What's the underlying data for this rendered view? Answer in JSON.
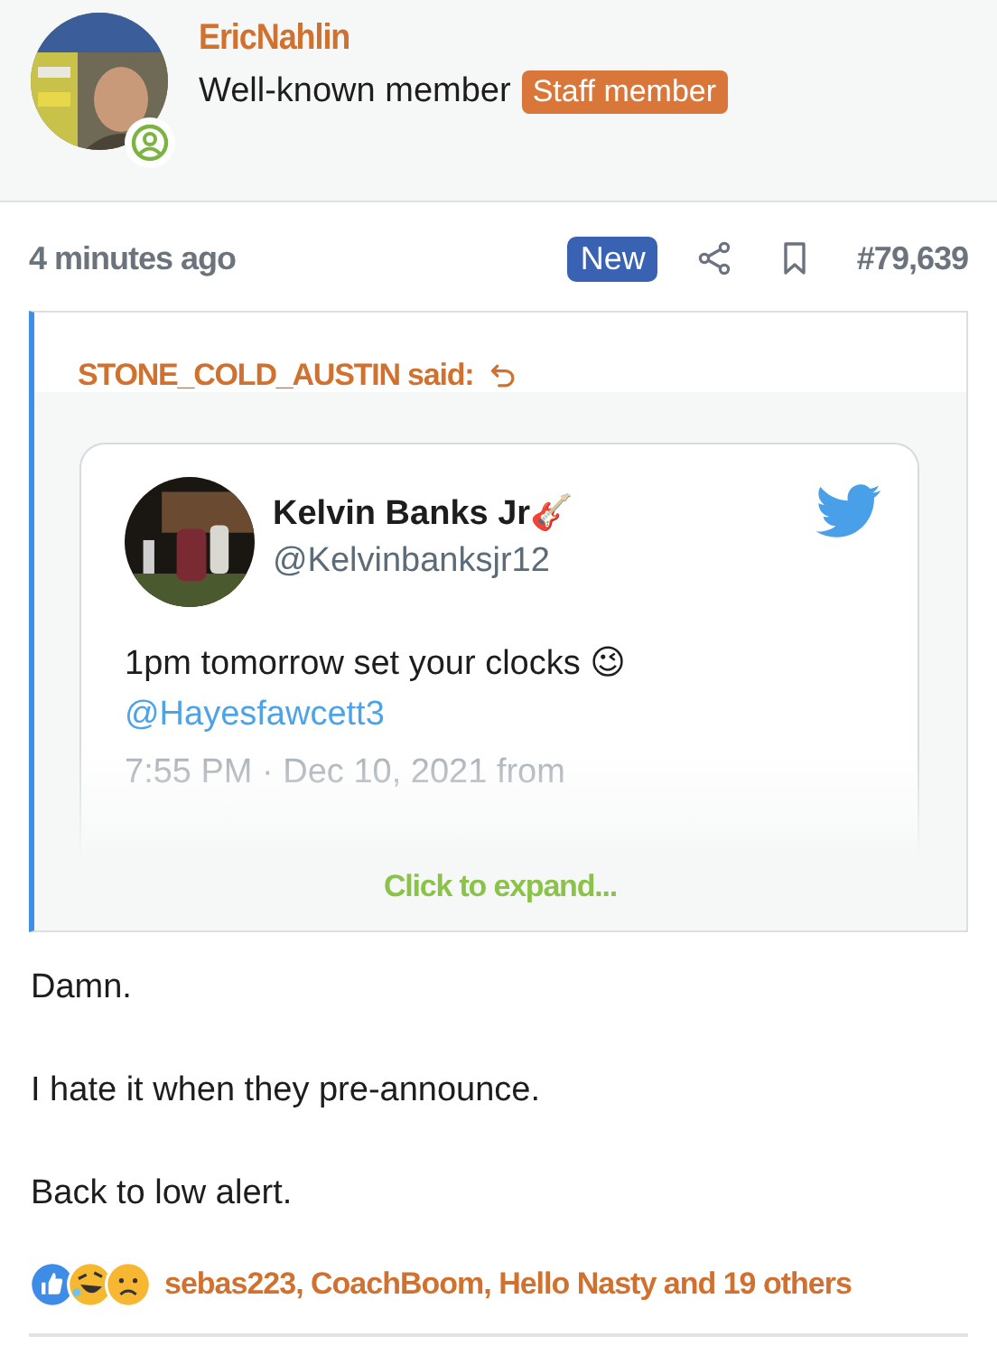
{
  "author": {
    "name": "EricNahlin",
    "title": "Well-known member",
    "badge": "Staff member",
    "online": true
  },
  "post": {
    "time": "4 minutes ago",
    "new_label": "New",
    "number": "#79,639"
  },
  "quote": {
    "attribution": "STONE_COLD_AUSTIN said:",
    "tweet": {
      "name": "Kelvin Banks Jr🎸",
      "handle": "@Kelvinbanksjr12",
      "text": "1pm tomorrow set your clocks 😉",
      "mention": "@Hayesfawcett3",
      "meta": "7:55 PM · Dec 10, 2021 from"
    },
    "expand": "Click to expand..."
  },
  "body": [
    "Damn.",
    "I hate it when they pre-announce.",
    "Back to low alert."
  ],
  "reactions": {
    "icons": [
      {
        "kind": "like"
      },
      {
        "kind": "haha"
      },
      {
        "kind": "sad"
      }
    ],
    "text": "sebas223, CoachBoom, Hello Nasty and 19 others"
  }
}
